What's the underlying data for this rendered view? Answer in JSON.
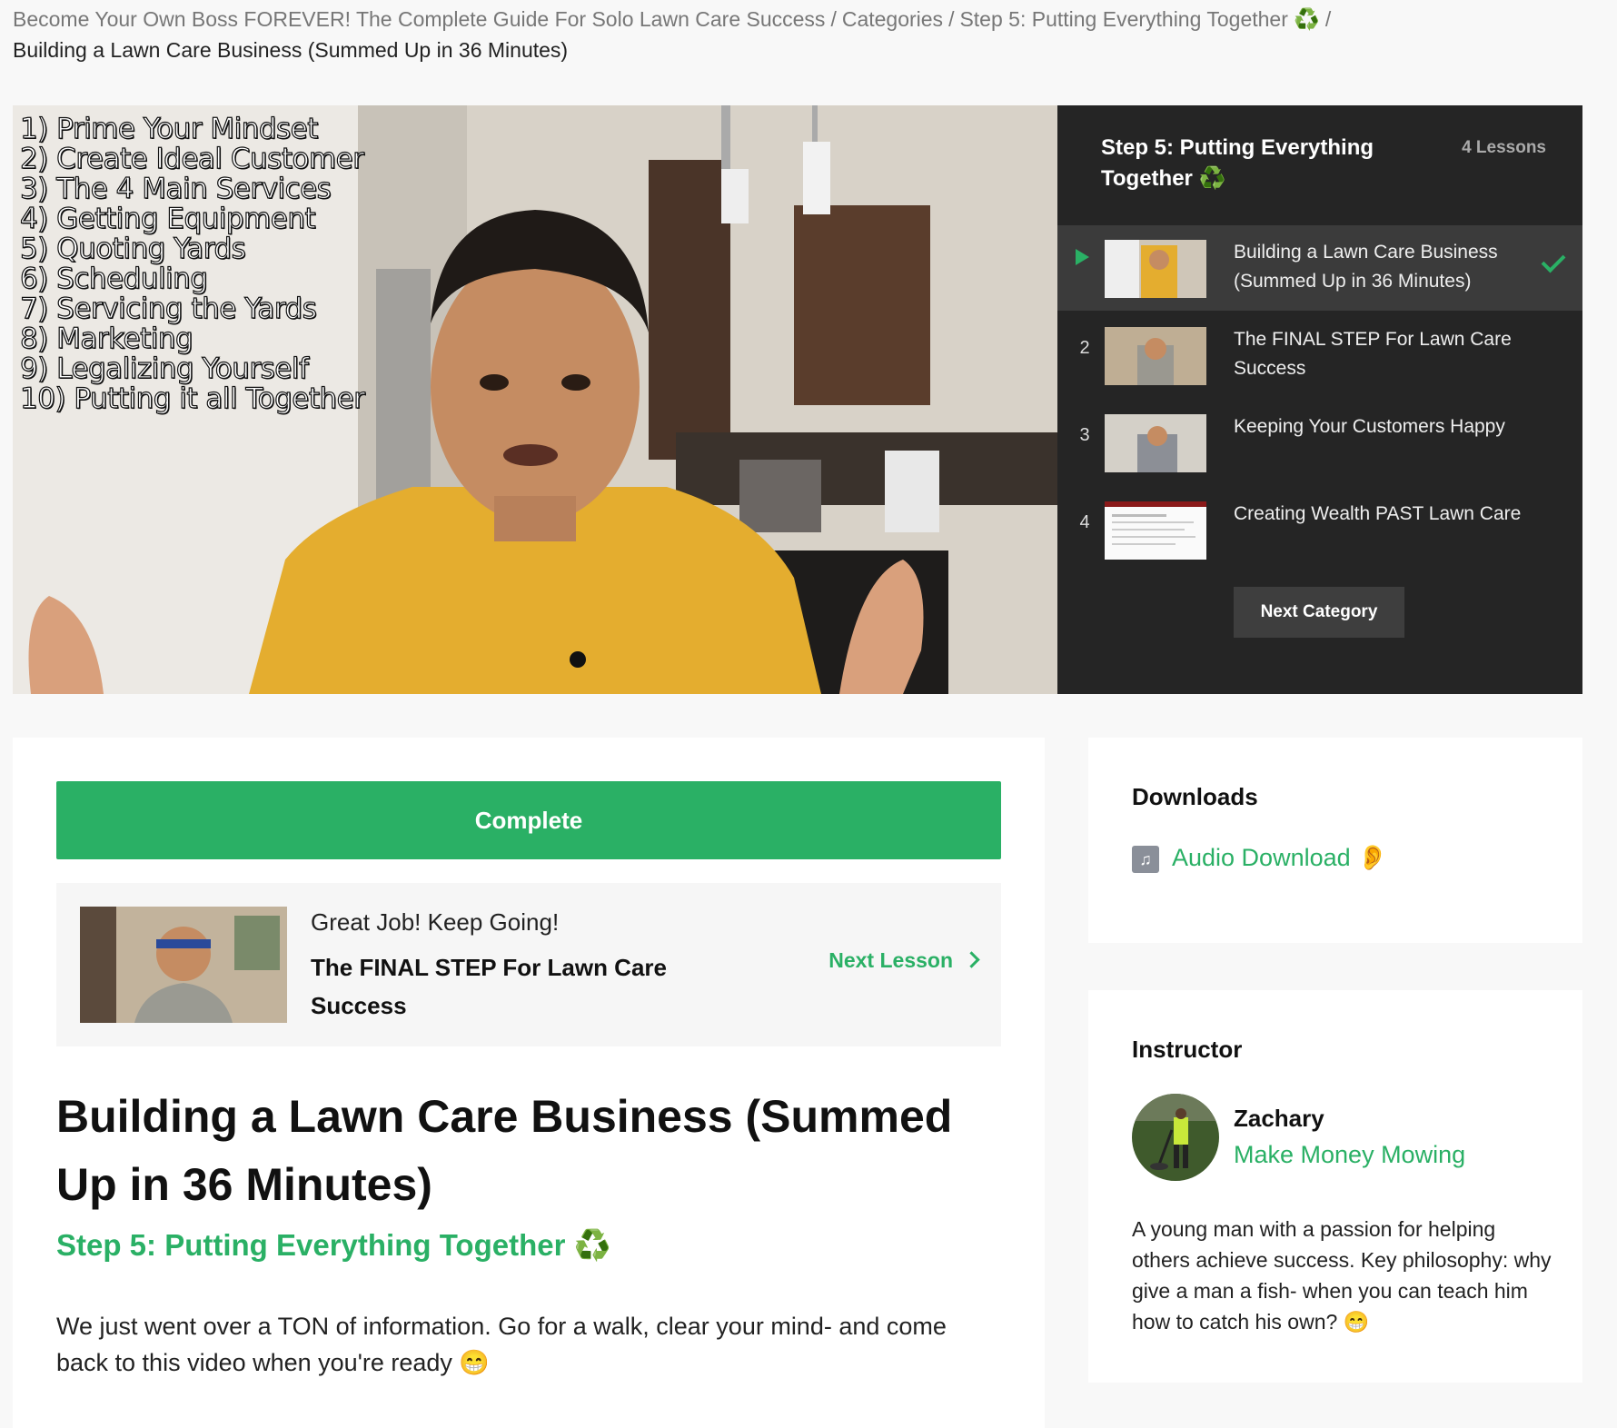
{
  "breadcrumb": {
    "course": "Become Your Own Boss FOREVER! The Complete Guide For Solo Lawn Care Success",
    "categories": "Categories",
    "step": "Step 5: Putting Everything Together ♻️",
    "separator": "/",
    "current": "Building a Lawn Care Business (Summed Up in 36 Minutes)"
  },
  "video": {
    "topics": [
      "1) Prime Your Mindset",
      "2) Create Ideal Customer",
      "3) The 4 Main Services",
      "4) Getting Equipment",
      "5) Quoting Yards",
      "6) Scheduling",
      "7) Servicing the Yards",
      "8) Marketing",
      "9) Legalizing Yourself",
      "10) Putting it all Together"
    ]
  },
  "sidebar": {
    "title": "Step 5: Putting Everything Together ♻️",
    "lesson_count": "4 Lessons",
    "lessons": [
      {
        "num": "",
        "title": "Building a Lawn Care Business (Summed Up in 36 Minutes)",
        "active": true,
        "completed": true
      },
      {
        "num": "2",
        "title": "The FINAL STEP For Lawn Care Success",
        "active": false,
        "completed": false
      },
      {
        "num": "3",
        "title": "Keeping Your Customers Happy",
        "active": false,
        "completed": false
      },
      {
        "num": "4",
        "title": "Creating Wealth PAST Lawn Care",
        "active": false,
        "completed": false
      }
    ],
    "next_category": "Next Category"
  },
  "main": {
    "complete_label": "Complete",
    "next_box": {
      "encouragement": "Great Job! Keep Going!",
      "title": "The FINAL STEP For Lawn Care Success",
      "link_label": "Next Lesson"
    },
    "lesson_title": "Building a Lawn Care Business (Summed Up in 36 Minutes)",
    "step_subtitle": "Step 5: Putting Everything Together ♻️",
    "description": "We just went over a TON of information. Go for a walk, clear your mind- and come back to this video when you're ready 😁"
  },
  "downloads": {
    "heading": "Downloads",
    "audio_label": "Audio Download 👂",
    "icon": "music-note-icon"
  },
  "instructor": {
    "heading": "Instructor",
    "name": "Zachary",
    "subtitle": "Make Money Mowing",
    "bio": "A young man with a passion for helping others achieve success. Key philosophy: why give a man a fish- when you can teach him how to catch his own? 😁"
  },
  "colors": {
    "accent": "#2ab065",
    "sidebar_bg": "#252525",
    "active_lesson_bg": "#3b3b3b",
    "page_bg": "#f8f8f8"
  }
}
